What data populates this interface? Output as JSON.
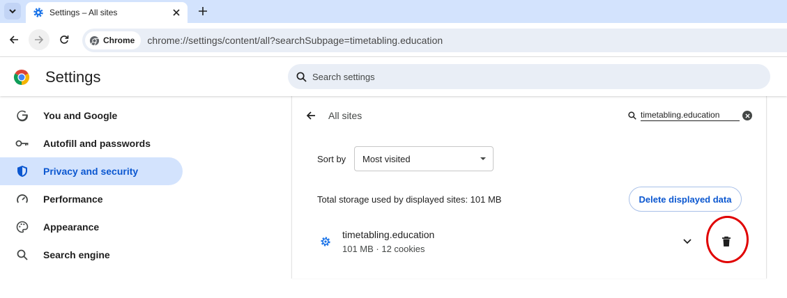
{
  "browser": {
    "tab_title": "Settings – All sites",
    "omnibox_chip": "Chrome",
    "url": "chrome://settings/content/all?searchSubpage=timetabling.education"
  },
  "settings": {
    "title": "Settings",
    "search_placeholder": "Search settings"
  },
  "sidebar": {
    "items": [
      {
        "label": "You and Google",
        "icon": "google-g-icon"
      },
      {
        "label": "Autofill and passwords",
        "icon": "key-icon"
      },
      {
        "label": "Privacy and security",
        "icon": "shield-icon",
        "active": true
      },
      {
        "label": "Performance",
        "icon": "gauge-icon"
      },
      {
        "label": "Appearance",
        "icon": "palette-icon"
      },
      {
        "label": "Search engine",
        "icon": "search-icon"
      }
    ]
  },
  "main": {
    "title": "All sites",
    "filter_value": "timetabling.education",
    "sort_label": "Sort by",
    "sort_value": "Most visited",
    "storage_summary": "Total storage used by displayed sites: 101 MB",
    "delete_button": "Delete displayed data",
    "sites": [
      {
        "name": "timetabling.education",
        "meta": "101 MB · 12 cookies"
      }
    ]
  },
  "colors": {
    "accent": "#0b57d0",
    "active_nav_bg": "#d3e3fd",
    "annotation_ring": "#e00000"
  }
}
